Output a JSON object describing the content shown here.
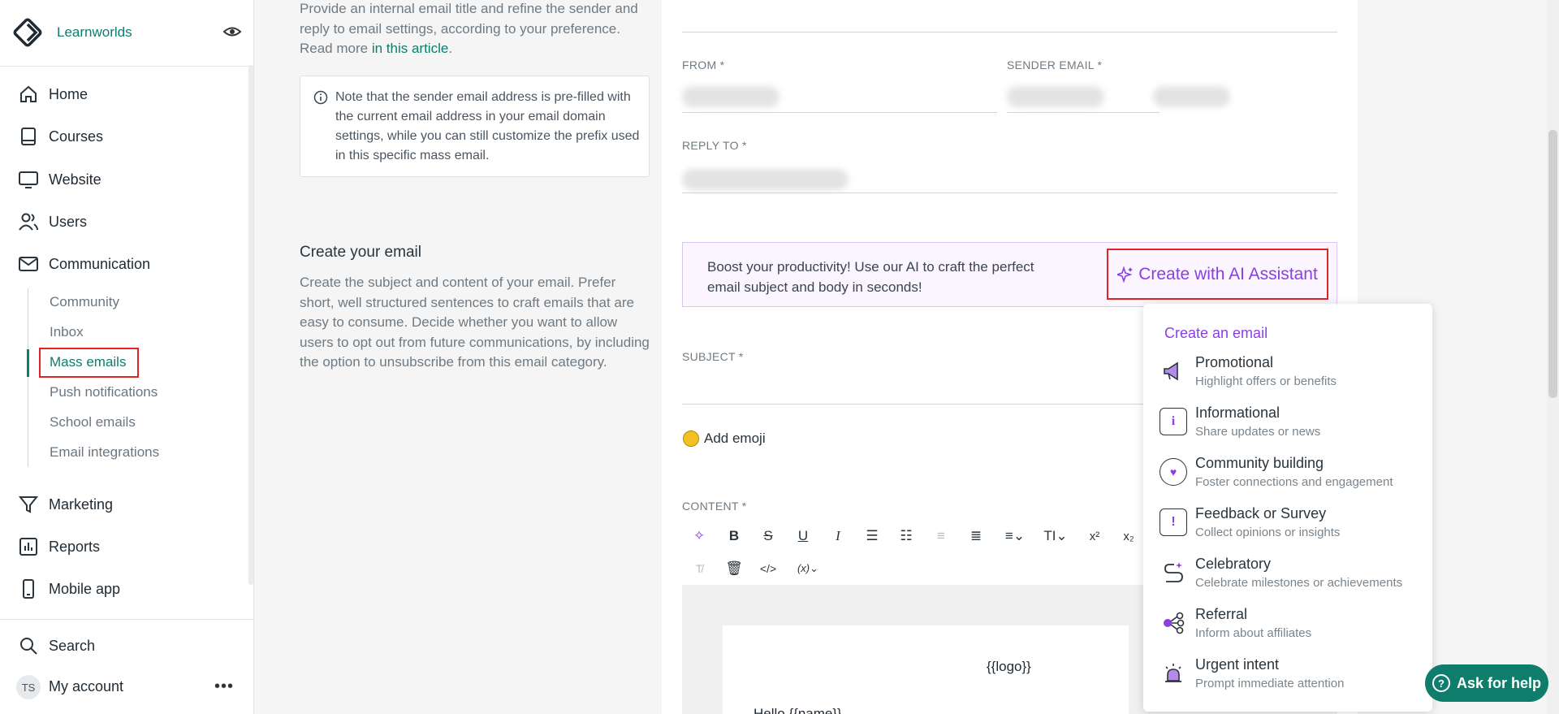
{
  "brand": {
    "name": "Learnworlds"
  },
  "sidebar": {
    "items": [
      {
        "label": "Home",
        "icon": "home-icon"
      },
      {
        "label": "Courses",
        "icon": "book-icon"
      },
      {
        "label": "Website",
        "icon": "monitor-icon"
      },
      {
        "label": "Users",
        "icon": "users-icon"
      },
      {
        "label": "Communication",
        "icon": "mail-icon"
      },
      {
        "label": "Marketing",
        "icon": "funnel-icon"
      },
      {
        "label": "Reports",
        "icon": "chart-icon"
      },
      {
        "label": "Mobile app",
        "icon": "phone-icon"
      }
    ],
    "sub_items": [
      "Community",
      "Inbox",
      "Mass emails",
      "Push notifications",
      "School emails",
      "Email integrations"
    ],
    "search_label": "Search",
    "account": {
      "initials": "TS",
      "label": "My account"
    }
  },
  "intro": {
    "text": "Provide an internal email title and refine the sender and reply to email settings, according to your preference. Read more ",
    "link": "in this article",
    "link_suffix": "."
  },
  "note": "Note that the sender email address is pre-filled with the current email address in your email domain settings, while you can still customize the prefix used in this specific mass email.",
  "create_section": {
    "title": "Create your email",
    "description": "Create the subject and content of your email. Prefer short, well structured sentences to craft emails that are easy to consume. Decide whether you want to allow users to opt out from future communications, by including the option to unsubscribe from this email category."
  },
  "fields": {
    "from_label": "FROM *",
    "sender_label": "SENDER EMAIL *",
    "reply_label": "REPLY TO *",
    "subject_label": "SUBJECT *",
    "content_label": "CONTENT *"
  },
  "ai_banner": {
    "text": "Boost your productivity! Use our AI to craft the perfect email subject and body in seconds!",
    "button": "Create with AI Assistant"
  },
  "add_emoji": "Add emoji",
  "editor": {
    "logo_var": "{{logo}}",
    "hello_var": "Hello {{name}},"
  },
  "dropdown": {
    "header": "Create an email",
    "items": [
      {
        "title": "Promotional",
        "desc": "Highlight offers or benefits",
        "icon": "megaphone-icon"
      },
      {
        "title": "Informational",
        "desc": "Share updates or news",
        "icon": "info-screen-icon"
      },
      {
        "title": "Community building",
        "desc": "Foster connections and engagement",
        "icon": "community-icon"
      },
      {
        "title": "Feedback or Survey",
        "desc": "Collect opinions or insights",
        "icon": "feedback-icon"
      },
      {
        "title": "Celebratory",
        "desc": "Celebrate milestones or achievements",
        "icon": "celebration-icon"
      },
      {
        "title": "Referral",
        "desc": "Inform about affiliates",
        "icon": "share-icon"
      },
      {
        "title": "Urgent intent",
        "desc": "Prompt immediate attention",
        "icon": "alarm-icon"
      }
    ]
  },
  "help_button": "Ask for help",
  "colors": {
    "brand": "#0f7d6c",
    "ai_accent": "#8a3fe0",
    "highlight": "#e02424"
  }
}
